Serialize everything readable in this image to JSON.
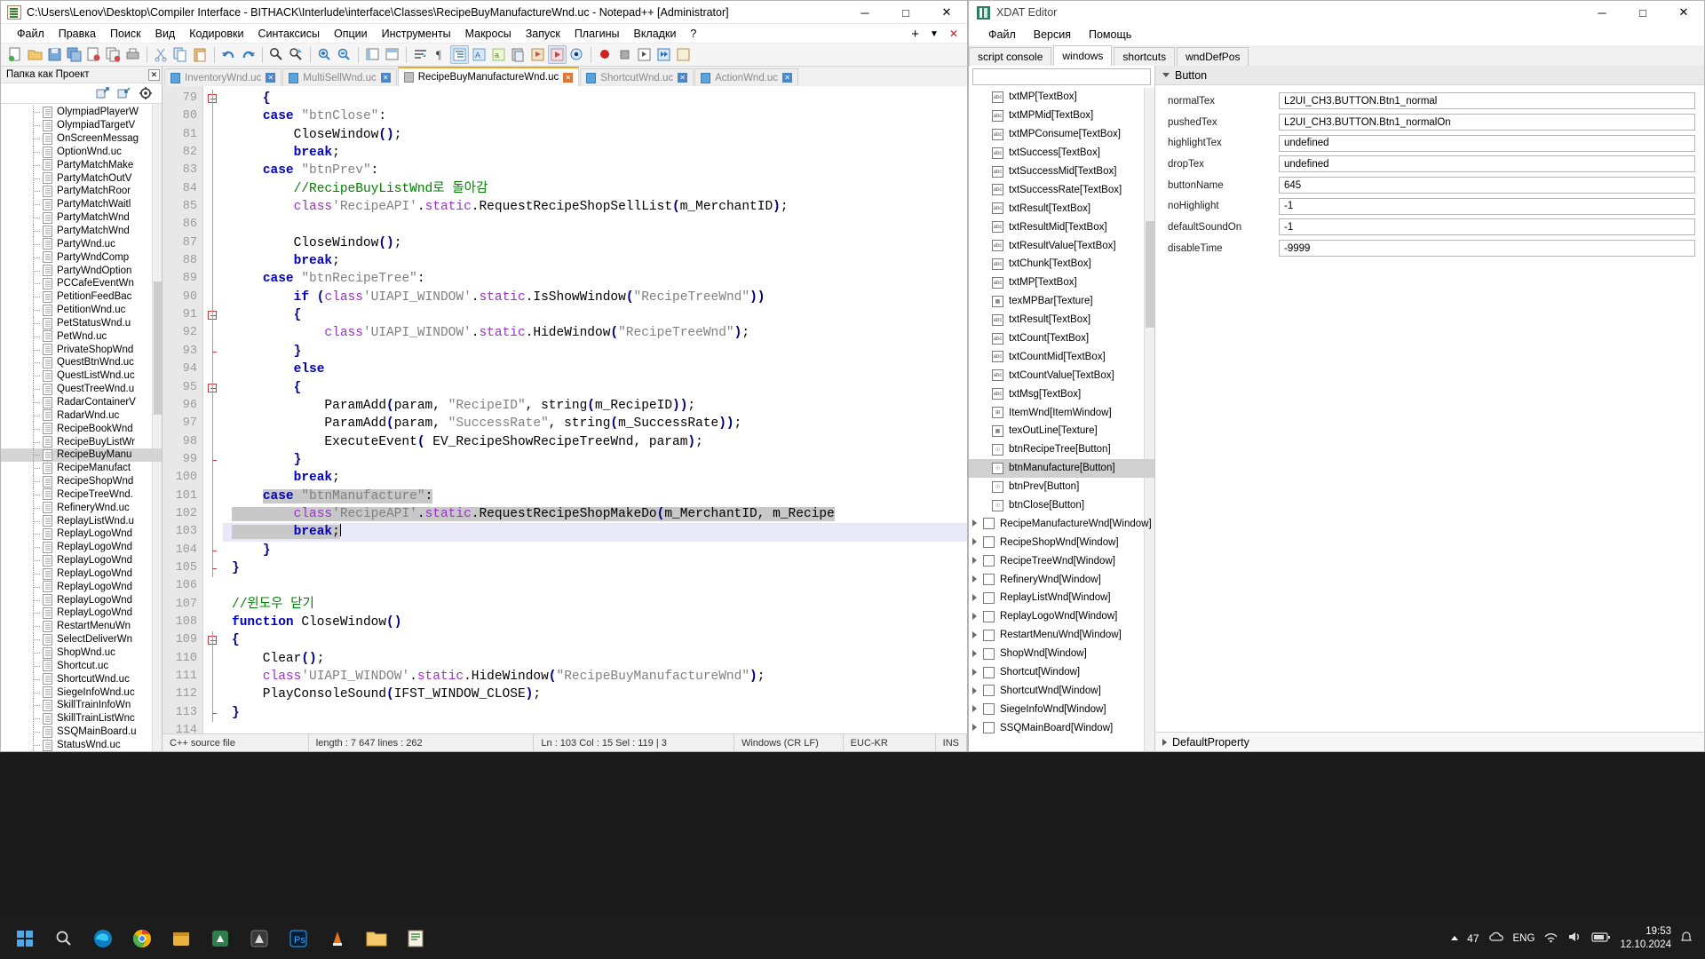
{
  "notepadpp": {
    "title": "C:\\Users\\Lenov\\Desktop\\Compiler  Interface - BITHACK\\Interlude\\interface\\Classes\\RecipeBuyManufactureWnd.uc - Notepad++ [Administrator]",
    "window_buttons": {
      "minimize": "─",
      "maximize": "□",
      "close": "✕"
    },
    "menu": [
      "Файл",
      "Правка",
      "Поиск",
      "Вид",
      "Кодировки",
      "Синтаксисы",
      "Опции",
      "Инструменты",
      "Макросы",
      "Запуск",
      "Плагины",
      "Вкладки",
      "?"
    ],
    "doc_buttons": {
      "add": "+",
      "list": "▼",
      "close": "✕"
    },
    "dock": {
      "title": "Папка как Проект",
      "close": "✕",
      "tools": [
        "expand-all-icon",
        "collapse-all-icon",
        "locate-icon"
      ],
      "files": [
        "OlympiadPlayerW",
        "OlympiadTargetV",
        "OnScreenMessag",
        "OptionWnd.uc",
        "PartyMatchMake",
        "PartyMatchOutV",
        "PartyMatchRoor",
        "PartyMatchWaitl",
        "PartyMatchWnd",
        "PartyMatchWnd",
        "PartyWnd.uc",
        "PartyWndComp",
        "PartyWndOption",
        "PCCafeEventWn",
        "PetitionFeedBac",
        "PetitionWnd.uc",
        "PetStatusWnd.u",
        "PetWnd.uc",
        "PrivateShopWnd",
        "QuestBtnWnd.uc",
        "QuestListWnd.uc",
        "QuestTreeWnd.u",
        "RadarContainerV",
        "RadarWnd.uc",
        "RecipeBookWnd",
        "RecipeBuyListWr",
        "RecipeBuyManu",
        "RecipeManufact",
        "RecipeShopWnd",
        "RecipeTreeWnd.",
        "RefineryWnd.uc",
        "ReplayListWnd.u",
        "ReplayLogoWnd",
        "ReplayLogoWnd",
        "ReplayLogoWnd",
        "ReplayLogoWnd",
        "ReplayLogoWnd",
        "ReplayLogoWnd",
        "ReplayLogoWnd",
        "RestartMenuWn",
        "SelectDeliverWn",
        "ShopWnd.uc",
        "Shortcut.uc",
        "ShortcutWnd.uc",
        "SiegeInfoWnd.uc",
        "SkillTrainInfoWn",
        "SkillTrainListWnc",
        "SSQMainBoard.u",
        "StatusWnd.uc"
      ],
      "selected_file": "RecipeBuyManu"
    },
    "tabs": [
      {
        "label": "InventoryWnd.uc",
        "active": false
      },
      {
        "label": "MultiSellWnd.uc",
        "active": false
      },
      {
        "label": "RecipeBuyManufactureWnd.uc",
        "active": true
      },
      {
        "label": "ShortcutWnd.uc",
        "active": false
      },
      {
        "label": "ActionWnd.uc",
        "active": false
      }
    ],
    "first_line_number": 79,
    "code_lines": [
      {
        "n": 79,
        "fold": "open",
        "html": "    <span class=\"op\">{</span>"
      },
      {
        "n": 80,
        "fold": "",
        "html": "    <span class=\"kw\">case</span> <span class=\"str\">\"btnClose\"</span>:"
      },
      {
        "n": 81,
        "fold": "",
        "html": "        CloseWindow<span class=\"op\">()</span>;"
      },
      {
        "n": 82,
        "fold": "",
        "html": "        <span class=\"kw\">break</span>;"
      },
      {
        "n": 83,
        "fold": "",
        "html": "    <span class=\"kw\">case</span> <span class=\"str\">\"btnPrev\"</span>:"
      },
      {
        "n": 84,
        "fold": "",
        "html": "        <span class=\"cmt\">//RecipeBuyListWnd로 돌아감</span>"
      },
      {
        "n": 85,
        "fold": "",
        "html": "        <span class=\"cls\">class</span><span class=\"str\">'RecipeAPI'</span>.<span class=\"cls\">static</span>.RequestRecipeShopSellList<span class=\"op\">(</span>m_MerchantID<span class=\"op\">)</span>;"
      },
      {
        "n": 86,
        "fold": "",
        "html": ""
      },
      {
        "n": 87,
        "fold": "",
        "html": "        CloseWindow<span class=\"op\">()</span>;"
      },
      {
        "n": 88,
        "fold": "",
        "html": "        <span class=\"kw\">break</span>;"
      },
      {
        "n": 89,
        "fold": "",
        "html": "    <span class=\"kw\">case</span> <span class=\"str\">\"btnRecipeTree\"</span>:"
      },
      {
        "n": 90,
        "fold": "",
        "html": "        <span class=\"kw\">if</span> <span class=\"op\">(</span><span class=\"cls\">class</span><span class=\"str\">'UIAPI_WINDOW'</span>.<span class=\"cls\">static</span>.IsShowWindow<span class=\"op\">(</span><span class=\"str\">\"RecipeTreeWnd\"</span><span class=\"op\">))</span>"
      },
      {
        "n": 91,
        "fold": "open",
        "html": "        <span class=\"op\">{</span>"
      },
      {
        "n": 92,
        "fold": "",
        "html": "            <span class=\"cls\">class</span><span class=\"str\">'UIAPI_WINDOW'</span>.<span class=\"cls\">static</span>.HideWindow<span class=\"op\">(</span><span class=\"str\">\"RecipeTreeWnd\"</span><span class=\"op\">)</span>;"
      },
      {
        "n": 93,
        "fold": "end",
        "html": "        <span class=\"op\">}</span>"
      },
      {
        "n": 94,
        "fold": "",
        "html": "        <span class=\"kw\">else</span>"
      },
      {
        "n": 95,
        "fold": "open",
        "html": "        <span class=\"op\">{</span>"
      },
      {
        "n": 96,
        "fold": "",
        "html": "            ParamAdd<span class=\"op\">(</span>param, <span class=\"str\">\"RecipeID\"</span>, string<span class=\"op\">(</span>m_RecipeID<span class=\"op\">))</span>;"
      },
      {
        "n": 97,
        "fold": "",
        "html": "            ParamAdd<span class=\"op\">(</span>param, <span class=\"str\">\"SuccessRate\"</span>, string<span class=\"op\">(</span>m_SuccessRate<span class=\"op\">))</span>;"
      },
      {
        "n": 98,
        "fold": "",
        "html": "            ExecuteEvent<span class=\"op\">(</span> EV_RecipeShowRecipeTreeWnd, param<span class=\"op\">)</span>;"
      },
      {
        "n": 99,
        "fold": "end",
        "html": "        <span class=\"op\">}</span>"
      },
      {
        "n": 100,
        "fold": "",
        "html": "        <span class=\"kw\">break</span>;"
      },
      {
        "n": 101,
        "fold": "",
        "html": "    <span class=\"sel\"><span class=\"kw\">case</span> <span class=\"str\">\"btnManufacture\"</span>:</span>"
      },
      {
        "n": 102,
        "fold": "",
        "html": "<span class=\"sel\">        <span class=\"cls\">class</span><span class=\"str\">'RecipeAPI'</span>.<span class=\"cls\">static</span>.RequestRecipeShopMakeDo<span class=\"op\">(</span>m_MerchantID, m_Recipe</span>"
      },
      {
        "n": 103,
        "fold": "",
        "html": "<span class=\"sel\">        <span class=\"kw\">break</span>;</span><span class=\"caret\"></span>"
      },
      {
        "n": 104,
        "fold": "end",
        "html": "    <span class=\"op\">}</span>"
      },
      {
        "n": 105,
        "fold": "end",
        "html": "<span class=\"op\">}</span>"
      },
      {
        "n": 106,
        "fold": "",
        "html": ""
      },
      {
        "n": 107,
        "fold": "",
        "html": "<span class=\"cmt\">//윈도우 닫기</span>"
      },
      {
        "n": 108,
        "fold": "",
        "html": "<span class=\"kw\">function</span> CloseWindow<span class=\"op\">()</span>"
      },
      {
        "n": 109,
        "fold": "open",
        "html": "<span class=\"op\">{</span>"
      },
      {
        "n": 110,
        "fold": "",
        "html": "    Clear<span class=\"op\">()</span>;"
      },
      {
        "n": 111,
        "fold": "",
        "html": "    <span class=\"cls\">class</span><span class=\"str\">'UIAPI_WINDOW'</span>.<span class=\"cls\">static</span>.HideWindow<span class=\"op\">(</span><span class=\"str\">\"RecipeBuyManufactureWnd\"</span><span class=\"op\">)</span>;"
      },
      {
        "n": 112,
        "fold": "",
        "html": "    PlayConsoleSound<span class=\"op\">(</span>IFST_WINDOW_CLOSE<span class=\"op\">)</span>;"
      },
      {
        "n": 113,
        "fold": "end",
        "html": "<span class=\"op\">}</span>"
      },
      {
        "n": 114,
        "fold": "",
        "html": ""
      }
    ],
    "cursor_line": 103,
    "status": {
      "doc_type": "C++ source file",
      "length_lines": "length : 7 647    lines : 262",
      "position": "Ln : 103   Col : 15   Sel : 119 | 3",
      "eol": "Windows (CR LF)",
      "encoding": "EUC-KR",
      "insert_mode": "INS"
    }
  },
  "xdat": {
    "title": "XDAT Editor",
    "window_buttons": {
      "minimize": "─",
      "maximize": "□",
      "close": "✕"
    },
    "menu": [
      "Файл",
      "Версия",
      "Помощь"
    ],
    "tabs": [
      {
        "label": "script console",
        "active": false
      },
      {
        "label": "windows",
        "active": true
      },
      {
        "label": "shortcuts",
        "active": false
      },
      {
        "label": "wndDefPos",
        "active": false
      }
    ],
    "search_value": "",
    "tree": [
      {
        "label": "txtMP[TextBox]",
        "icon": "abc",
        "kind": "child",
        "selected": false
      },
      {
        "label": "txtMPMid[TextBox]",
        "icon": "abc",
        "kind": "child",
        "selected": false
      },
      {
        "label": "txtMPConsume[TextBox]",
        "icon": "abc",
        "kind": "child",
        "selected": false
      },
      {
        "label": "txtSuccess[TextBox]",
        "icon": "abc",
        "kind": "child",
        "selected": false
      },
      {
        "label": "txtSuccessMid[TextBox]",
        "icon": "abc",
        "kind": "child",
        "selected": false
      },
      {
        "label": "txtSuccessRate[TextBox]",
        "icon": "abc",
        "kind": "child",
        "selected": false
      },
      {
        "label": "txtResult[TextBox]",
        "icon": "abc",
        "kind": "child",
        "selected": false
      },
      {
        "label": "txtResultMid[TextBox]",
        "icon": "abc",
        "kind": "child",
        "selected": false
      },
      {
        "label": "txtResultValue[TextBox]",
        "icon": "abc",
        "kind": "child",
        "selected": false
      },
      {
        "label": "txtChunk[TextBox]",
        "icon": "abc",
        "kind": "child",
        "selected": false
      },
      {
        "label": "txtMP[TextBox]",
        "icon": "abc",
        "kind": "child",
        "selected": false
      },
      {
        "label": "texMPBar[Texture]",
        "icon": "img",
        "kind": "child",
        "selected": false
      },
      {
        "label": "txtResult[TextBox]",
        "icon": "abc",
        "kind": "child",
        "selected": false
      },
      {
        "label": "txtCount[TextBox]",
        "icon": "abc",
        "kind": "child",
        "selected": false
      },
      {
        "label": "txtCountMid[TextBox]",
        "icon": "abc",
        "kind": "child",
        "selected": false
      },
      {
        "label": "txtCountValue[TextBox]",
        "icon": "abc",
        "kind": "child",
        "selected": false
      },
      {
        "label": "txtMsg[TextBox]",
        "icon": "abc",
        "kind": "child",
        "selected": false
      },
      {
        "label": "ItemWnd[ItemWindow]",
        "icon": "grid",
        "kind": "child",
        "selected": false
      },
      {
        "label": "texOutLine[Texture]",
        "icon": "img",
        "kind": "child",
        "selected": false
      },
      {
        "label": "btnRecipeTree[Button]",
        "icon": "btn",
        "kind": "child",
        "selected": false
      },
      {
        "label": "btnManufacture[Button]",
        "icon": "btn",
        "kind": "child",
        "selected": true
      },
      {
        "label": "btnPrev[Button]",
        "icon": "btn",
        "kind": "child",
        "selected": false
      },
      {
        "label": "btnClose[Button]",
        "icon": "btn",
        "kind": "child",
        "selected": false
      },
      {
        "label": "RecipeManufactureWnd[Window]",
        "icon": "win",
        "kind": "root",
        "selected": false
      },
      {
        "label": "RecipeShopWnd[Window]",
        "icon": "win",
        "kind": "root",
        "selected": false
      },
      {
        "label": "RecipeTreeWnd[Window]",
        "icon": "win",
        "kind": "root",
        "selected": false
      },
      {
        "label": "RefineryWnd[Window]",
        "icon": "win",
        "kind": "root",
        "selected": false
      },
      {
        "label": "ReplayListWnd[Window]",
        "icon": "win",
        "kind": "root",
        "selected": false
      },
      {
        "label": "ReplayLogoWnd[Window]",
        "icon": "win",
        "kind": "root",
        "selected": false
      },
      {
        "label": "RestartMenuWnd[Window]",
        "icon": "win",
        "kind": "root",
        "selected": false
      },
      {
        "label": "ShopWnd[Window]",
        "icon": "win",
        "kind": "root",
        "selected": false
      },
      {
        "label": "Shortcut[Window]",
        "icon": "win",
        "kind": "root",
        "selected": false
      },
      {
        "label": "ShortcutWnd[Window]",
        "icon": "win",
        "kind": "root",
        "selected": false
      },
      {
        "label": "SiegeInfoWnd[Window]",
        "icon": "win",
        "kind": "root",
        "selected": false
      },
      {
        "label": "SSQMainBoard[Window]",
        "icon": "win",
        "kind": "root",
        "selected": false
      }
    ],
    "property_group": "Button",
    "properties": [
      {
        "key": "normalTex",
        "value": "L2UI_CH3.BUTTON.Btn1_normal"
      },
      {
        "key": "pushedTex",
        "value": "L2UI_CH3.BUTTON.Btn1_normalOn"
      },
      {
        "key": "highlightTex",
        "value": "undefined"
      },
      {
        "key": "dropTex",
        "value": "undefined"
      },
      {
        "key": "buttonName",
        "value": "645"
      },
      {
        "key": "noHighlight",
        "value": "-1"
      },
      {
        "key": "defaultSoundOn",
        "value": "-1"
      },
      {
        "key": "disableTime",
        "value": "-9999"
      }
    ],
    "footer": "DefaultProperty"
  },
  "taskbar": {
    "items": [
      "start-icon",
      "search-icon",
      "edge-icon",
      "chrome-icon",
      "store-icon",
      "app-icon-1",
      "app-icon-2",
      "photoshop-icon",
      "vlc-icon",
      "folder-icon",
      "notepadpp-icon"
    ],
    "tray": {
      "chevron": "▲",
      "count": "47",
      "language": "ENG",
      "time": "19:53",
      "date": "12.10.2024"
    }
  }
}
